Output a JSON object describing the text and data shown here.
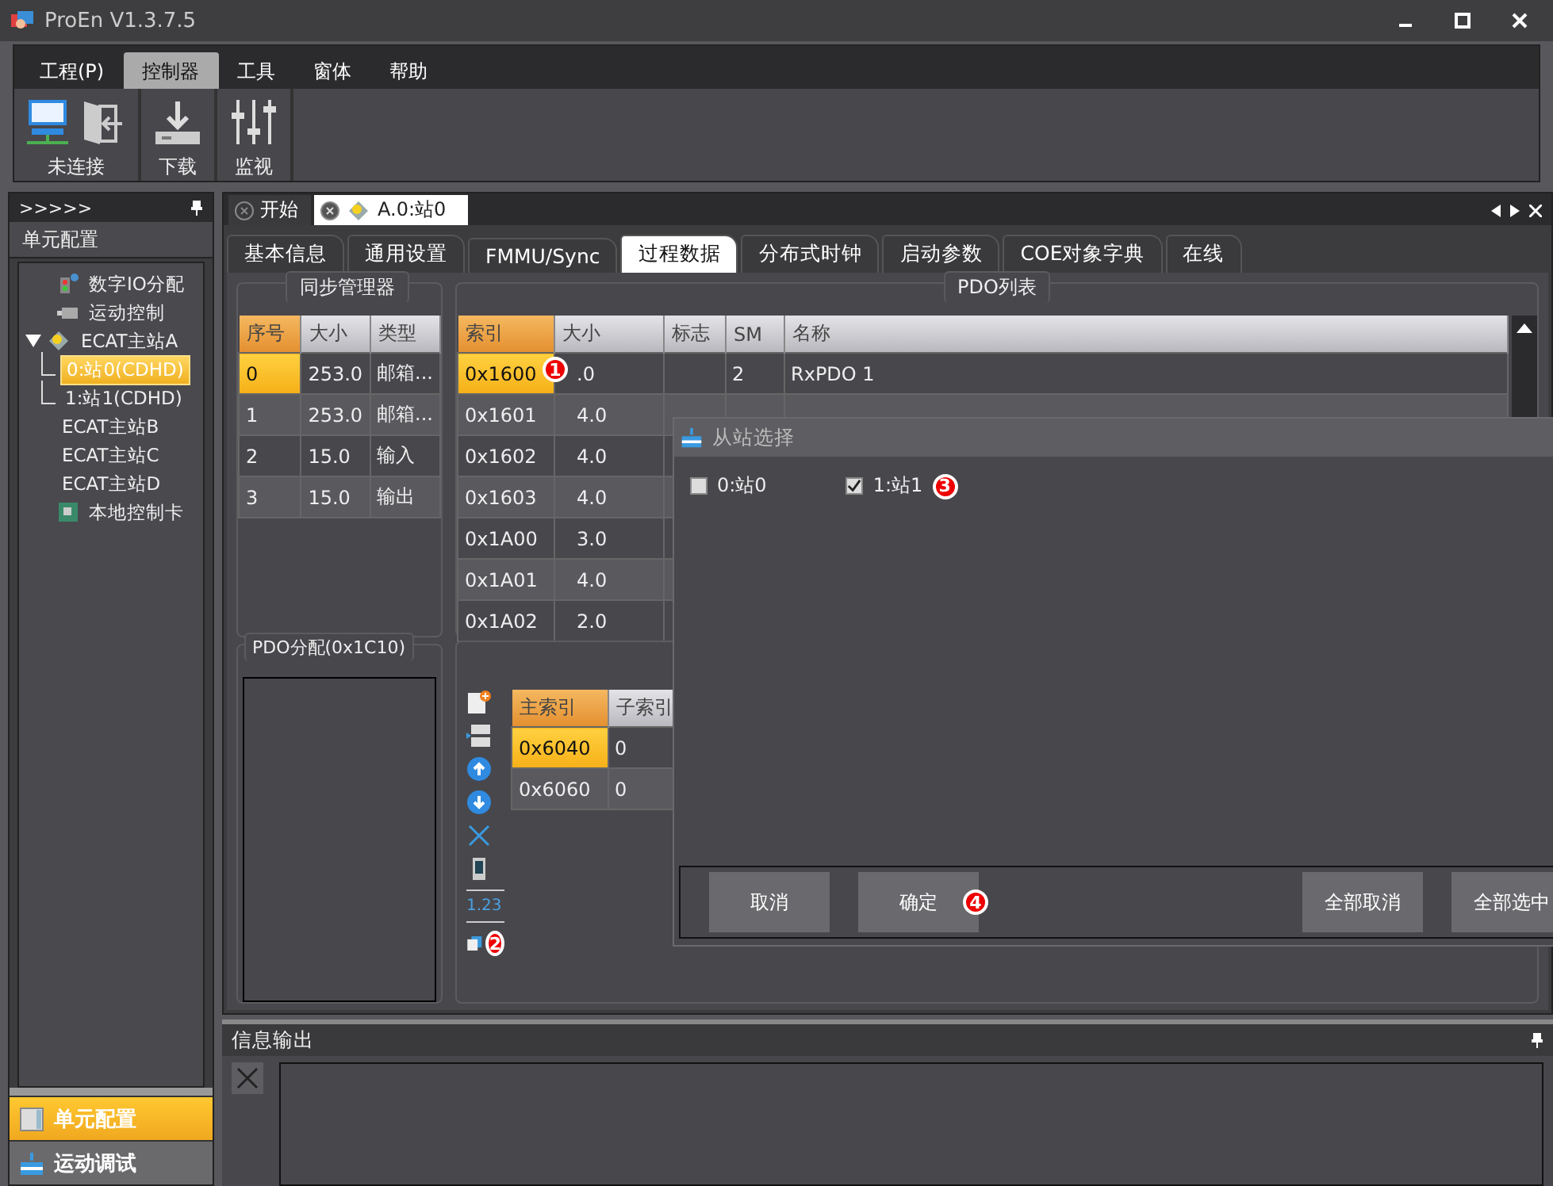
{
  "window": {
    "title": "ProEn V1.3.7.5"
  },
  "menu": [
    {
      "label": "工程(P)",
      "selected": false
    },
    {
      "label": "控制器",
      "selected": true
    },
    {
      "label": "工具",
      "selected": false
    },
    {
      "label": "窗体",
      "selected": false
    },
    {
      "label": "帮助",
      "selected": false
    }
  ],
  "toolbar": [
    {
      "label": "未连接",
      "kind": "connect"
    },
    {
      "label": "下载",
      "kind": "download"
    },
    {
      "label": "监视",
      "kind": "monitor"
    }
  ],
  "left_panel": {
    "header": ">>>>>",
    "title": "单元配置",
    "tree": [
      {
        "label": "数字IO分配",
        "kind": "io",
        "selected": false
      },
      {
        "label": "运动控制",
        "kind": "motion",
        "selected": false
      },
      {
        "label": "ECAT主站A",
        "kind": "master",
        "selected": false,
        "expanded": true,
        "children": [
          {
            "label": "0:站0(CDHD)",
            "selected": true
          },
          {
            "label": "1:站1(CDHD)",
            "selected": false
          }
        ]
      },
      {
        "label": "ECAT主站B",
        "kind": "plain",
        "selected": false
      },
      {
        "label": "ECAT主站C",
        "kind": "plain",
        "selected": false
      },
      {
        "label": "ECAT主站D",
        "kind": "plain",
        "selected": false
      },
      {
        "label": "本地控制卡",
        "kind": "card",
        "selected": false
      }
    ],
    "nav": [
      {
        "label": "单元配置",
        "kind": "config",
        "selected": true
      },
      {
        "label": "运动调试",
        "kind": "debug",
        "selected": false
      }
    ]
  },
  "doc_tabs": [
    {
      "label": "开始",
      "kind": "start",
      "selected": false
    },
    {
      "label": "A.0:站0",
      "kind": "station",
      "selected": true
    }
  ],
  "tabs": [
    {
      "label": "基本信息",
      "selected": false
    },
    {
      "label": "通用设置",
      "selected": false
    },
    {
      "label": "FMMU/Sync",
      "selected": false
    },
    {
      "label": "过程数据",
      "selected": true
    },
    {
      "label": "分布式时钟",
      "selected": false
    },
    {
      "label": "启动参数",
      "selected": false
    },
    {
      "label": "COE对象字典",
      "selected": false
    },
    {
      "label": "在线",
      "selected": false
    }
  ],
  "sync_manager": {
    "title": "同步管理器",
    "columns": [
      "序号",
      "大小",
      "类型"
    ],
    "rows": [
      {
        "cells": [
          "0",
          "253.0",
          "邮箱..."
        ],
        "selected": true
      },
      {
        "cells": [
          "1",
          "253.0",
          "邮箱..."
        ],
        "selected": false
      },
      {
        "cells": [
          "2",
          "15.0",
          "输入"
        ],
        "selected": false
      },
      {
        "cells": [
          "3",
          "15.0",
          "输出"
        ],
        "selected": false
      }
    ]
  },
  "pdo_list": {
    "title": "PDO列表",
    "columns": [
      "索引",
      "大小",
      "标志",
      "SM",
      "名称"
    ],
    "rows": [
      {
        "cells": [
          "0x1600",
          ".0",
          "",
          "2",
          "RxPDO 1"
        ],
        "selected": true
      },
      {
        "cells": [
          "0x1601",
          "4.0"
        ],
        "selected": false
      },
      {
        "cells": [
          "0x1602",
          "4.0"
        ],
        "selected": false
      },
      {
        "cells": [
          "0x1603",
          "4.0"
        ],
        "selected": false
      },
      {
        "cells": [
          "0x1A00",
          "3.0"
        ],
        "selected": false
      },
      {
        "cells": [
          "0x1A01",
          "4.0"
        ],
        "selected": false
      },
      {
        "cells": [
          "0x1A02",
          "2.0"
        ],
        "selected": false
      }
    ]
  },
  "pdo_assign": {
    "title": "PDO分配(0x1C10)"
  },
  "pdo_entries": {
    "tool_text": "1.23",
    "columns": [
      "主索引",
      "子索引"
    ],
    "rows": [
      {
        "cells": [
          "0x6040",
          "0"
        ],
        "selected": true
      },
      {
        "cells": [
          "0x6060",
          "0"
        ],
        "selected": false
      }
    ]
  },
  "output": {
    "title": "信息输出"
  },
  "dialog": {
    "title": "从站选择",
    "options": [
      {
        "label": "0:站0",
        "checked": false
      },
      {
        "label": "1:站1",
        "checked": true
      }
    ],
    "buttons": [
      {
        "label": "取消",
        "kind": "cancel"
      },
      {
        "label": "确定",
        "kind": "ok"
      },
      {
        "label": "全部取消",
        "kind": "none"
      },
      {
        "label": "全部选中",
        "kind": "all"
      }
    ]
  },
  "markers": [
    "1",
    "2",
    "3",
    "4"
  ]
}
